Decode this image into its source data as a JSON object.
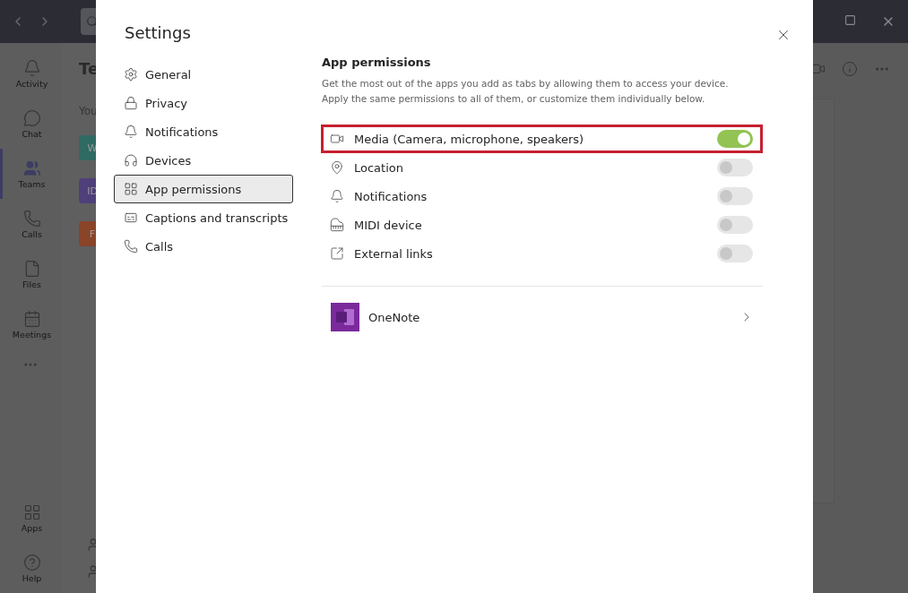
{
  "rail": {
    "items": [
      {
        "label": "Activity",
        "selected": false
      },
      {
        "label": "Chat",
        "selected": false
      },
      {
        "label": "Teams",
        "selected": true
      },
      {
        "label": "Calls",
        "selected": false
      },
      {
        "label": "Files",
        "selected": false
      },
      {
        "label": "Meetings",
        "selected": false
      }
    ],
    "bottom_items": [
      {
        "label": "Apps"
      },
      {
        "label": "Help"
      }
    ]
  },
  "team_list": {
    "title": "Te",
    "intro": "You",
    "tiles": [
      {
        "text": "W",
        "color": "#2f6b63"
      },
      {
        "text": "ID",
        "color": "#4f3f7a"
      },
      {
        "text": "F",
        "color": "#8a4428"
      }
    ]
  },
  "settings": {
    "title": "Settings",
    "nav": [
      {
        "label": "General",
        "selected": false
      },
      {
        "label": "Privacy",
        "selected": false
      },
      {
        "label": "Notifications",
        "selected": false
      },
      {
        "label": "Devices",
        "selected": false
      },
      {
        "label": "App permissions",
        "selected": true
      },
      {
        "label": "Captions and transcripts",
        "selected": false
      },
      {
        "label": "Calls",
        "selected": false
      }
    ],
    "section_title": "App permissions",
    "description": "Get the most out of the apps you add as tabs by allowing them to access your device.\nApply the same permissions to all of them, or customize them individually below.",
    "permissions": [
      {
        "label": "Media (Camera, microphone, speakers)",
        "on": true,
        "highlighted": true
      },
      {
        "label": "Location",
        "on": false,
        "highlighted": false
      },
      {
        "label": "Notifications",
        "on": false,
        "highlighted": false
      },
      {
        "label": "MIDI device",
        "on": false,
        "highlighted": false
      },
      {
        "label": "External links",
        "on": false,
        "highlighted": false
      }
    ],
    "apps": [
      {
        "name": "OneNote"
      }
    ]
  }
}
